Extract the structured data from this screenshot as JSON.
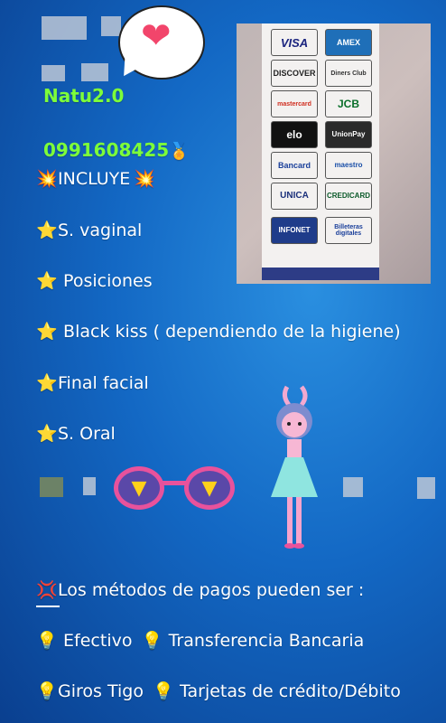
{
  "profile": {
    "name": "Natu2.0",
    "phone": "0991608425",
    "includes_title": "INCLUYE"
  },
  "services": [
    "S. vaginal",
    "Posiciones",
    "Black kiss ( dependiendo de la higiene)",
    "Final facial",
    "S. Oral"
  ],
  "payments": {
    "title": "Los métodos de pagos pueden ser :",
    "row1a": "Efectivo",
    "row1b": "Transferencia Bancaria",
    "row2a": "Giros Tigo",
    "row2b": "Tarjetas de crédito/Débito"
  },
  "card_logos": [
    "VISA",
    "AMEX",
    "DISCOVER",
    "Diners Club",
    "mastercard",
    "JCB",
    "elo",
    "UnionPay",
    "Bancard",
    "maestro",
    "UNICA",
    "CREDICARD",
    "INFONET",
    "Billeteras digitales"
  ],
  "colors": {
    "accent_green": "#7dff3a",
    "background": "#1368c4"
  }
}
